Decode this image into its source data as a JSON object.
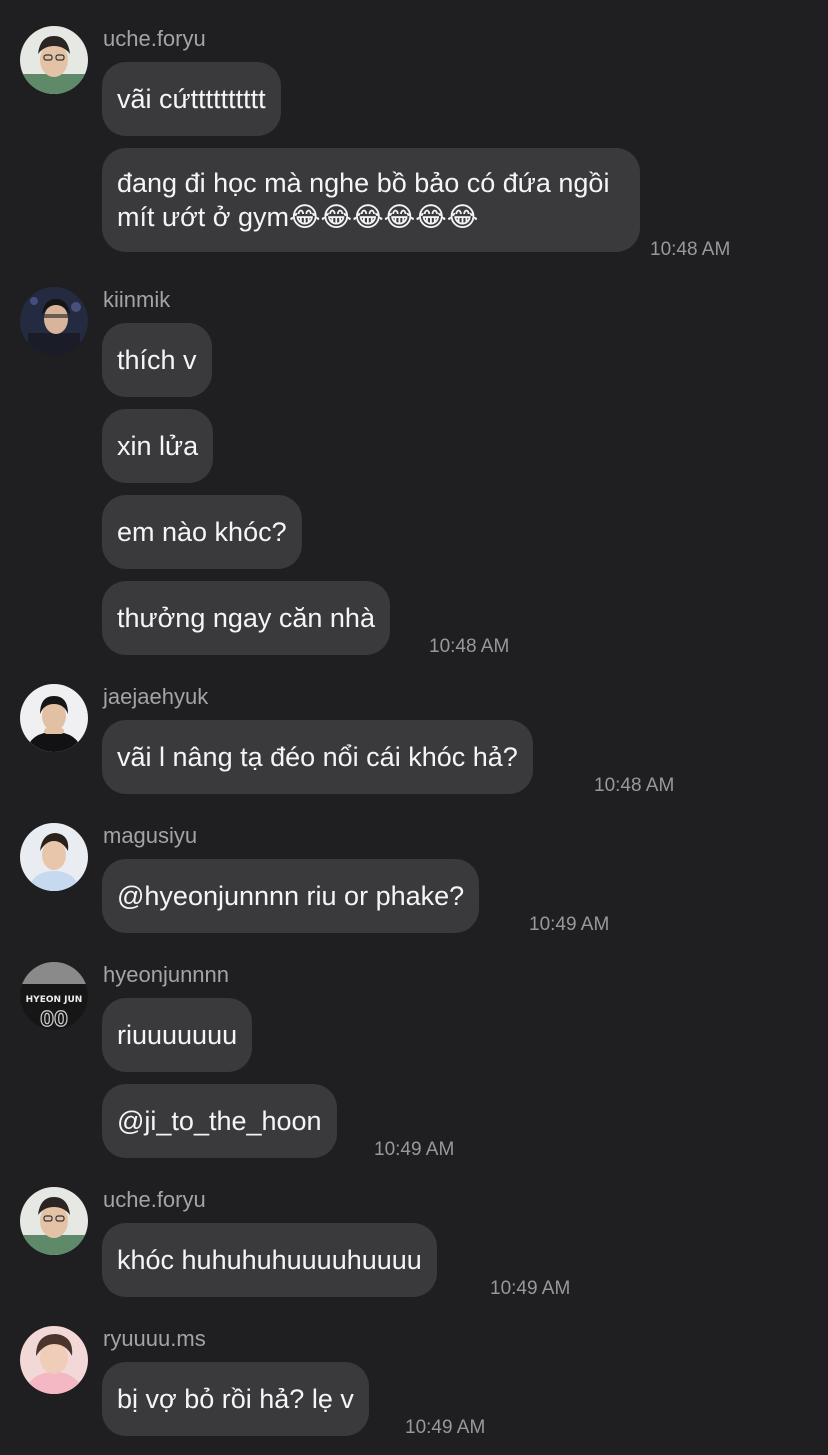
{
  "messages": [
    {
      "username": "uche.foryu",
      "avatar": "avatar-uche",
      "bubbles": [
        "vãi cứtttttttttt",
        "đang đi học mà nghe bồ bảo có đứa ngồi mít ướt ở gym😂😂😂😂😂😂"
      ],
      "time": "10:48 AM"
    },
    {
      "username": "kiinmik",
      "avatar": "avatar-kiinmik",
      "bubbles": [
        "thích v",
        "xin lửa",
        "em nào khóc?",
        "thưởng ngay căn nhà"
      ],
      "time": "10:48 AM"
    },
    {
      "username": "jaejaehyuk",
      "avatar": "avatar-jaejaehyuk",
      "bubbles": [
        "vãi l nâng tạ đéo nổi cái khóc hả?"
      ],
      "time": "10:48 AM"
    },
    {
      "username": "magusiyu",
      "avatar": "avatar-magusiyu",
      "bubbles": [
        "@hyeonjunnnn riu or phake?"
      ],
      "time": "10:49 AM"
    },
    {
      "username": "hyeonjunnnn",
      "avatar": "avatar-hyeonjunnnn",
      "avatar_text": "HYEON JUN",
      "bubbles": [
        "riuuuuuuu",
        "@ji_to_the_hoon"
      ],
      "time": "10:49 AM"
    },
    {
      "username": "uche.foryu",
      "avatar": "avatar-uche",
      "bubbles": [
        "khóc huhuhuhuuuuhuuuu"
      ],
      "time": "10:49 AM"
    },
    {
      "username": "ryuuuu.ms",
      "avatar": "avatar-ryuuuu",
      "bubbles": [
        "bị vợ bỏ rồi hả? lẹ v"
      ],
      "time": "10:49 AM"
    }
  ],
  "colors": {
    "background": "#1f1f21",
    "bubble": "#3a3a3c",
    "text": "#f5f5f7",
    "meta": "#a3a3a8"
  }
}
